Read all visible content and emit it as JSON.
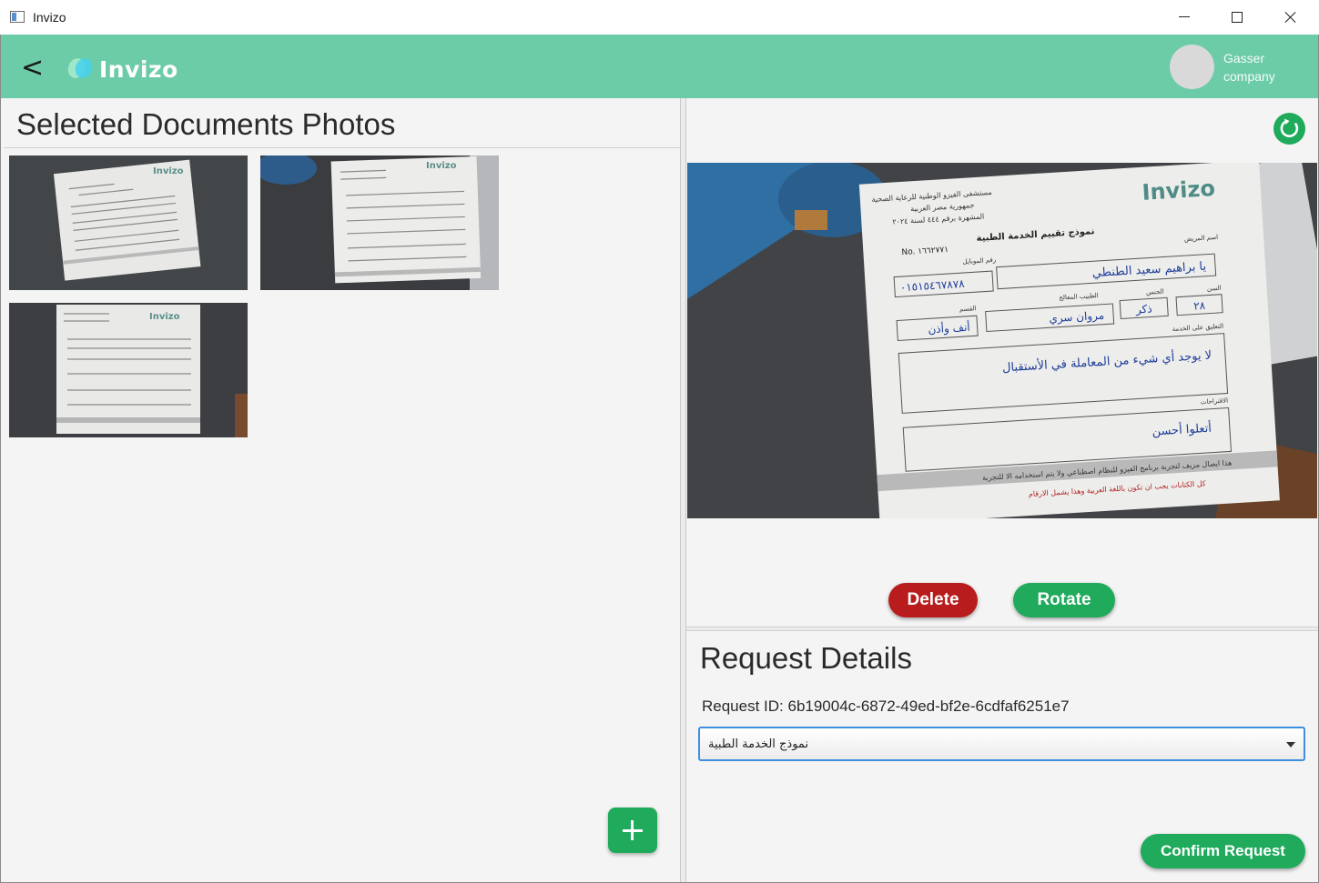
{
  "window": {
    "title": "Invizo"
  },
  "header": {
    "back_label": "<",
    "brand": "Invizo",
    "user": {
      "name": "Gasser",
      "company": "company"
    }
  },
  "left": {
    "title": "Selected Documents Photos",
    "thumbnails": [
      {
        "label": "Invizo"
      },
      {
        "label": "Invizo"
      },
      {
        "label": "Invizo"
      }
    ]
  },
  "preview": {
    "brand": "Invizo",
    "hospital_line1": "مستشفى الفيزو الوطنية للرعاية الصحية",
    "hospital_line2": "جمهورية مصر العربية",
    "hospital_line3": "المشهرة برقم ٤٤٤ لسنة ٢٠٢٤",
    "form_title": "نموذج تقييم الخدمة الطبية",
    "number_label": "No. ١٦٦٢٧٧١",
    "field_patient": "اسم المريض",
    "field_mobile": "رقم الموبايل",
    "value_patient": "يا براهيم سعيد الطنطي",
    "value_mobile": "٠١٥١٥٤٦٧٨٧٨",
    "field_age": "السن",
    "field_gender": "الجنس",
    "field_doctor": "الطبيب المعالج",
    "field_department": "القسم",
    "value_age": "٢٨",
    "value_gender": "ذكر",
    "value_doctor": "مروان سري",
    "value_department": "أنف وأذن",
    "field_comment": "التعليق على الخدمة",
    "value_comment": "لا يوجد أي شيء من المعاملة في الأستقبال",
    "field_suggestions": "الاقتراحات",
    "value_suggestions": "أتعلوا أحسن",
    "footer1": "هذا ايصال مزيف لتجربة برنامج الفيزو للنظام اصطناعي ولا يتم استخدامه الا للتجربة",
    "footer2": "كل الكتابات يجب ان تكون باللغة العربية وهذا يشمل الارقام"
  },
  "actions": {
    "delete_label": "Delete",
    "rotate_label": "Rotate"
  },
  "details": {
    "title": "Request Details",
    "request_id": "Request ID: 6b19004c-6872-49ed-bf2e-6cdfaf6251e7",
    "selected_form": "نموذج الخدمة الطبية",
    "confirm_label": "Confirm Request"
  },
  "icons": {
    "app": "window-app-icon",
    "back": "chevron-left-icon",
    "refresh": "refresh-icon",
    "add": "plus-icon",
    "dropdown": "caret-down-icon"
  },
  "colors": {
    "header": "#6ccca8",
    "primary": "#1faa5c",
    "danger": "#b81c1c",
    "focus": "#3d8fe0"
  }
}
